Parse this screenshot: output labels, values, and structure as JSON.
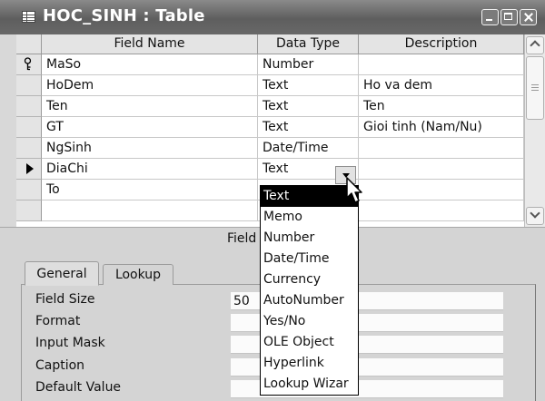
{
  "window": {
    "title": "HOC_SINH : Table"
  },
  "grid": {
    "headers": {
      "field_name": "Field Name",
      "data_type": "Data Type",
      "description": "Description"
    },
    "rows": [
      {
        "field_name": "MaSo",
        "data_type": "Number",
        "description": "",
        "marker": "key"
      },
      {
        "field_name": "HoDem",
        "data_type": "Text",
        "description": "Ho va dem",
        "marker": ""
      },
      {
        "field_name": "Ten",
        "data_type": "Text",
        "description": "Ten",
        "marker": ""
      },
      {
        "field_name": "GT",
        "data_type": "Text",
        "description": "Gioi tinh (Nam/Nu)",
        "marker": ""
      },
      {
        "field_name": "NgSinh",
        "data_type": "Date/Time",
        "description": "",
        "marker": ""
      },
      {
        "field_name": "DiaChi",
        "data_type": "Text",
        "description": "",
        "marker": "current"
      },
      {
        "field_name": "To",
        "data_type": "",
        "description": "",
        "marker": ""
      },
      {
        "field_name": "",
        "data_type": "",
        "description": "",
        "marker": ""
      }
    ]
  },
  "data_type_dropdown": {
    "selected": "Text",
    "options": [
      "Text",
      "Memo",
      "Number",
      "Date/Time",
      "Currency",
      "AutoNumber",
      "Yes/No",
      "OLE Object",
      "Hyperlink",
      "Lookup Wizar"
    ]
  },
  "field_properties": {
    "section_label": "Field",
    "tabs": [
      "General",
      "Lookup"
    ],
    "active_tab": "General",
    "rows": [
      {
        "label": "Field Size",
        "value": "50"
      },
      {
        "label": "Format",
        "value": ""
      },
      {
        "label": "Input Mask",
        "value": ""
      },
      {
        "label": "Caption",
        "value": ""
      },
      {
        "label": "Default Value",
        "value": ""
      }
    ]
  },
  "icons": {
    "title": "table-icon",
    "key": "primary-key-icon",
    "current_row": "row-pointer-icon",
    "combo": "chevron-down-icon",
    "cursor": "mouse-pointer-icon"
  }
}
